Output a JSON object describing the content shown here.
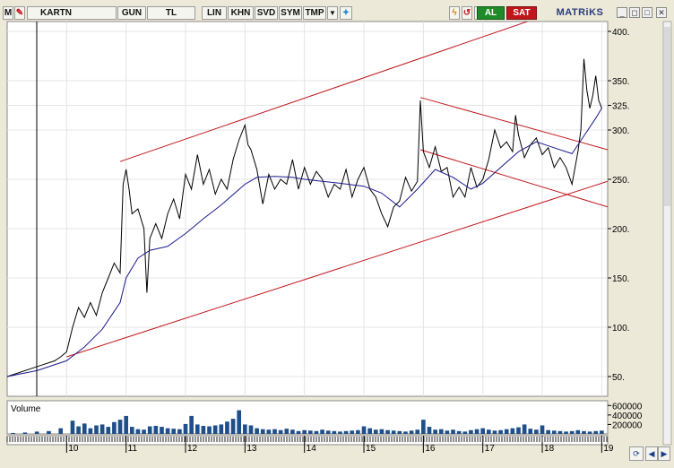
{
  "toolbar": {
    "m_label": "M",
    "symbol": "KARTN",
    "period": "GUN",
    "currency": "TL",
    "scale": "LIN",
    "khn": "KHN",
    "svd": "SVD",
    "sym": "SYM",
    "tmp": "TMP",
    "buy_label": "AL",
    "sell_label": "SAT",
    "brand": "MATRiKS"
  },
  "colors": {
    "price": "#000000",
    "moving_average": "#1a1a8c",
    "trend_lines": "#c0161b",
    "volume": "#1f4f8a",
    "grid": "#e4e4e4",
    "axis": "#000000"
  },
  "chart_data": [
    {
      "type": "line",
      "panel": "price",
      "ylim": [
        30,
        410
      ],
      "y_ticks": [
        50,
        100,
        150,
        200,
        250,
        300,
        325,
        350,
        400
      ],
      "y_tick_labels": [
        "50.",
        "100.",
        "150.",
        "200.",
        "250.",
        "300.",
        "325.",
        "350.",
        "400."
      ],
      "x_tick_labels": [
        "10",
        "11",
        "12",
        "13",
        "14",
        "15",
        "16",
        "17",
        "18",
        "19"
      ],
      "x_range": [
        9.0,
        19.1
      ],
      "grid": true,
      "series": [
        {
          "role": "price",
          "x": [
            9.0,
            9.2,
            9.4,
            9.6,
            9.8,
            9.9,
            10.0,
            10.1,
            10.2,
            10.3,
            10.4,
            10.5,
            10.6,
            10.7,
            10.8,
            10.9,
            10.95,
            11.0,
            11.05,
            11.1,
            11.2,
            11.3,
            11.35,
            11.4,
            11.5,
            11.6,
            11.7,
            11.8,
            11.9,
            12.0,
            12.1,
            12.2,
            12.3,
            12.4,
            12.5,
            12.6,
            12.7,
            12.8,
            12.9,
            13.0,
            13.05,
            13.1,
            13.2,
            13.3,
            13.4,
            13.5,
            13.6,
            13.7,
            13.8,
            13.9,
            14.0,
            14.1,
            14.2,
            14.3,
            14.4,
            14.5,
            14.6,
            14.7,
            14.8,
            14.9,
            15.0,
            15.1,
            15.2,
            15.3,
            15.4,
            15.5,
            15.6,
            15.7,
            15.8,
            15.9,
            15.95,
            16.0,
            16.1,
            16.2,
            16.3,
            16.4,
            16.5,
            16.6,
            16.7,
            16.8,
            16.9,
            17.0,
            17.1,
            17.15,
            17.2,
            17.3,
            17.4,
            17.5,
            17.55,
            17.6,
            17.7,
            17.8,
            17.9,
            18.0,
            18.1,
            18.2,
            18.3,
            18.4,
            18.5,
            18.6,
            18.65,
            18.7,
            18.75,
            18.8,
            18.85,
            18.9,
            18.95,
            19.0
          ],
          "y": [
            50,
            54,
            58,
            62,
            66,
            70,
            75,
            100,
            120,
            110,
            125,
            112,
            135,
            150,
            165,
            155,
            245,
            260,
            240,
            215,
            220,
            200,
            135,
            190,
            205,
            190,
            215,
            230,
            210,
            255,
            240,
            275,
            245,
            260,
            235,
            250,
            240,
            270,
            290,
            305,
            285,
            280,
            260,
            225,
            255,
            240,
            250,
            245,
            270,
            240,
            262,
            245,
            258,
            250,
            232,
            245,
            240,
            260,
            232,
            250,
            262,
            240,
            232,
            215,
            202,
            222,
            228,
            252,
            238,
            248,
            330,
            278,
            262,
            283,
            258,
            262,
            232,
            242,
            232,
            262,
            242,
            250,
            270,
            285,
            300,
            282,
            288,
            278,
            315,
            295,
            272,
            285,
            292,
            275,
            282,
            262,
            272,
            262,
            245,
            278,
            300,
            372,
            340,
            322,
            335,
            355,
            330,
            322
          ]
        },
        {
          "role": "moving_average",
          "x": [
            9.0,
            9.5,
            10.0,
            10.3,
            10.6,
            10.9,
            11.0,
            11.2,
            11.4,
            11.7,
            12.0,
            12.3,
            12.6,
            13.0,
            13.2,
            13.5,
            13.8,
            14.0,
            14.3,
            14.6,
            15.0,
            15.3,
            15.6,
            15.9,
            16.2,
            16.5,
            16.8,
            17.0,
            17.3,
            17.6,
            17.9,
            18.2,
            18.5,
            18.7,
            18.9,
            19.0
          ],
          "y": [
            50,
            56,
            66,
            80,
            98,
            125,
            150,
            170,
            178,
            182,
            195,
            210,
            224,
            245,
            252,
            253,
            252,
            250,
            248,
            246,
            243,
            236,
            222,
            240,
            260,
            252,
            240,
            246,
            262,
            278,
            288,
            282,
            276,
            294,
            312,
            322
          ]
        }
      ],
      "trend_lines": [
        {
          "role": "upper_channel",
          "x": [
            10.9,
            19.1
          ],
          "y": [
            268,
            438
          ]
        },
        {
          "role": "lower_channel",
          "x": [
            10.0,
            19.1
          ],
          "y": [
            70,
            248
          ]
        },
        {
          "role": "falling_upper",
          "x": [
            15.95,
            19.1
          ],
          "y": [
            333,
            280
          ]
        },
        {
          "role": "falling_lower",
          "x": [
            15.95,
            19.1
          ],
          "y": [
            280,
            222
          ]
        }
      ]
    },
    {
      "type": "bar",
      "panel": "volume",
      "title": "Volume",
      "ylim": [
        0,
        700000
      ],
      "y_ticks": [
        200000,
        400000,
        600000
      ],
      "y_tick_labels": [
        "200000",
        "400000",
        "600000"
      ],
      "x": [
        9.1,
        9.3,
        9.5,
        9.7,
        9.9,
        10.1,
        10.2,
        10.3,
        10.4,
        10.5,
        10.6,
        10.7,
        10.8,
        10.9,
        11.0,
        11.1,
        11.2,
        11.3,
        11.4,
        11.5,
        11.6,
        11.7,
        11.8,
        11.9,
        12.0,
        12.1,
        12.2,
        12.3,
        12.4,
        12.5,
        12.6,
        12.7,
        12.8,
        12.9,
        13.0,
        13.1,
        13.2,
        13.3,
        13.4,
        13.5,
        13.6,
        13.7,
        13.8,
        13.9,
        14.0,
        14.1,
        14.2,
        14.3,
        14.4,
        14.5,
        14.6,
        14.7,
        14.8,
        14.9,
        15.0,
        15.1,
        15.2,
        15.3,
        15.4,
        15.5,
        15.6,
        15.7,
        15.8,
        15.9,
        16.0,
        16.1,
        16.2,
        16.3,
        16.4,
        16.5,
        16.6,
        16.7,
        16.8,
        16.9,
        17.0,
        17.1,
        17.2,
        17.3,
        17.4,
        17.5,
        17.6,
        17.7,
        17.8,
        17.9,
        18.0,
        18.1,
        18.2,
        18.3,
        18.4,
        18.5,
        18.6,
        18.7,
        18.8,
        18.9,
        19.0
      ],
      "values": [
        20000,
        30000,
        50000,
        60000,
        120000,
        280000,
        160000,
        220000,
        120000,
        180000,
        200000,
        150000,
        250000,
        300000,
        380000,
        150000,
        100000,
        90000,
        160000,
        170000,
        150000,
        120000,
        110000,
        100000,
        210000,
        380000,
        200000,
        170000,
        160000,
        180000,
        200000,
        260000,
        320000,
        500000,
        200000,
        180000,
        120000,
        100000,
        90000,
        100000,
        80000,
        110000,
        90000,
        60000,
        80000,
        70000,
        60000,
        90000,
        70000,
        60000,
        50000,
        60000,
        70000,
        80000,
        160000,
        120000,
        90000,
        100000,
        80000,
        70000,
        60000,
        50000,
        70000,
        90000,
        300000,
        150000,
        90000,
        100000,
        70000,
        90000,
        60000,
        50000,
        80000,
        100000,
        120000,
        90000,
        70000,
        80000,
        100000,
        120000,
        140000,
        200000,
        110000,
        90000,
        180000,
        80000,
        70000,
        60000,
        50000,
        60000,
        80000,
        60000,
        50000,
        60000,
        70000
      ]
    }
  ]
}
